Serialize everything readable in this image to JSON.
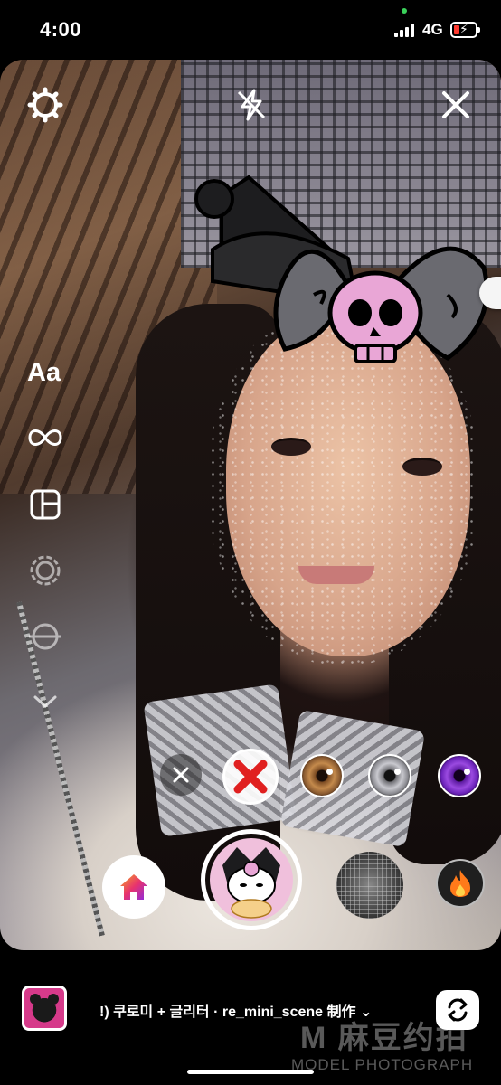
{
  "status_bar": {
    "time": "4:00",
    "network": "4G",
    "battery_level": 0.2,
    "battery_color": "#ff3b30"
  },
  "top_controls": {
    "settings_icon": "gear-icon",
    "flash_icon": "flash-off-icon",
    "close_icon": "close-icon"
  },
  "side_toolbar": {
    "text_label": "Aa",
    "items": [
      "text-tool",
      "boomerang-icon",
      "layout-icon",
      "multi-capture-icon",
      "level-icon",
      "chevron-down-icon"
    ]
  },
  "effects": {
    "close_chip_icon": "close-icon",
    "no_effect_icon": "red-x-icon",
    "eye_chips": [
      "brown-eye-lens",
      "grey-eye-lens",
      "purple-eye-lens"
    ],
    "home_icon": "home-icon",
    "face_mask_icon": "face-mesh-icon",
    "fire_icon": "fire-icon"
  },
  "bottom_bar": {
    "effect_name": "!) 쿠로미 + 글리터 · re_mini_scene 制作",
    "chevron": "⌄",
    "flip_icon": "camera-flip-icon"
  },
  "watermark": {
    "logo": "M 麻豆约拍",
    "text": "MODEL PHOTOGRAPH"
  }
}
